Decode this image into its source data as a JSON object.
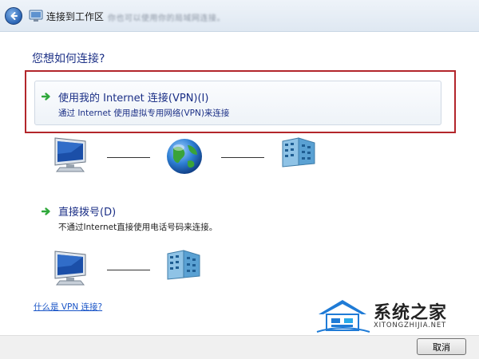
{
  "window": {
    "title": "连接到工作区",
    "subtitle_ghost": "你也可以使用你的局域网连接。"
  },
  "main": {
    "heading": "您想如何连接?",
    "options": [
      {
        "title": "使用我的 Internet 连接(VPN)(I)",
        "description": "通过 Internet 使用虚拟专用网络(VPN)来连接",
        "icon": "green-arrow-icon"
      },
      {
        "title": "直接拨号(D)",
        "description": "不通过Internet直接使用电话号码来连接。",
        "icon": "green-arrow-icon"
      }
    ],
    "help_link": "什么是 VPN 连接?"
  },
  "footer": {
    "cancel_label": "取消"
  },
  "watermark": {
    "name": "系统之家",
    "url": "XITONGZHIJIA.NET"
  },
  "colors": {
    "heading": "#1e3287",
    "highlight_border": "#b3262b",
    "link": "#1a55c7",
    "arrow": "#2fa83a"
  }
}
